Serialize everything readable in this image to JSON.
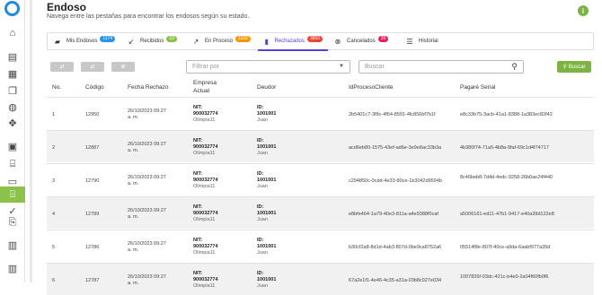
{
  "app": {
    "title": "Endoso",
    "subtitle": "Navega entre las pestañas para encontrar los endosos según su estado."
  },
  "sidebar": {
    "icons": [
      "home-icon",
      "bank-icon",
      "store-icon",
      "copy-icon",
      "globe-icon",
      "move-icon",
      "clipboard-icon",
      "institution-icon",
      "document-icon",
      "endoso-icon",
      "check-icon",
      "file-export-icon",
      "chart-icon",
      "report-icon"
    ]
  },
  "tabs": [
    {
      "label": "Mis Endosos",
      "badge": "1174",
      "color": "#2196f3",
      "icon": "folder-icon"
    },
    {
      "label": "Recibidos",
      "badge": "23",
      "color": "#8bc34a",
      "icon": "arrow-down-left-icon"
    },
    {
      "label": "En Proceso",
      "badge": "1169",
      "color": "#ff9800",
      "icon": "arrow-up-right-icon"
    },
    {
      "label": "Rechazados",
      "badge": "3850",
      "color": "#f44336",
      "icon": "file-icon"
    },
    {
      "label": "Cancelados",
      "badge": "39",
      "color": "#e91e63",
      "icon": "x-circle-icon"
    },
    {
      "label": "Historial",
      "badge": "",
      "color": "",
      "icon": "list-icon"
    }
  ],
  "toolbar": {
    "filter_placeholder": "Filtrar por",
    "search_placeholder": "Buscar",
    "search_button": "Buscar"
  },
  "table": {
    "headers": {
      "no": "No.",
      "codigo": "Código",
      "fecha": "Fecha Rechazo",
      "empresa": "Empresa Actual",
      "deudor": "Deudor",
      "proceso": "IdProcesoCliente",
      "pagare": "Pagaré Serial"
    },
    "rows": [
      {
        "no": "1",
        "codigo": "12950",
        "fecha": "26/10/2023 09:27",
        "ampm": "a. m.",
        "nit_label": "NIT:",
        "nit": "900032774",
        "empresa": "Olimpia11",
        "id_label": "ID:",
        "id": "1001001",
        "deudor": "Juan",
        "proceso": "2b5401c7-3f8c-4f64-8591-4fc856bf7b1f",
        "pagare": "e8c33b75-3acb-41a1-8388-1a383ec82f42"
      },
      {
        "no": "2",
        "codigo": "12887",
        "fecha": "26/10/2023 09:27",
        "ampm": "a. m.",
        "nit_label": "NIT:",
        "nit": "900032774",
        "empresa": "Olimpia11",
        "id_label": "ID:",
        "id": "1001001",
        "deudor": "Juan",
        "proceso": "acd6eb80-1575-43ef-ad6e-3e9e8ac33b3a",
        "pagare": "4b380f74-71a5-4b8a-9faf-69c1d4f74717"
      },
      {
        "no": "3",
        "codigo": "12790",
        "fecha": "26/10/2023 09:27",
        "ampm": "a. m.",
        "nit_label": "NIT:",
        "nit": "900032774",
        "empresa": "Olimpia11",
        "id_label": "ID:",
        "id": "1001001",
        "deudor": "Juan",
        "proceso": "c294850c-0cdd-4e33-80ce-1b3042d9594b",
        "pagare": "8c46beb8-7d4d-4edc-9258-26b0ae24f440"
      },
      {
        "no": "4",
        "codigo": "12789",
        "fecha": "26/10/2023 09:27",
        "ampm": "a. m.",
        "nit_label": "NIT:",
        "nit": "900032774",
        "empresa": "Olimpia11",
        "id_label": "ID:",
        "id": "1001001",
        "deudor": "Juan",
        "proceso": "e8bfe464-1a79-40e3-811a-a4e9388f0caf",
        "pagare": "a5006161-ed11-47b1-9417-e40a39d122e8"
      },
      {
        "no": "5",
        "codigo": "12786",
        "fecha": "26/10/2023 09:27",
        "ampm": "a. m.",
        "nit_label": "NIT:",
        "nit": "900032774",
        "empresa": "Olimpia11",
        "id_label": "ID:",
        "id": "1001001",
        "deudor": "Juan",
        "proceso": "b30cf2a8-8d1d-4ab3-807d-0be9ca8752a6",
        "pagare": "05514f8e-807f-40ce-a9da-6aabf977a35d"
      },
      {
        "no": "6",
        "codigo": "12787",
        "fecha": "26/10/2023 09:27",
        "ampm": "a. m.",
        "nit_label": "NIT:",
        "nit": "900032774",
        "empresa": "Olimpia11",
        "id_label": "ID:",
        "id": "1001001",
        "deudor": "Juan",
        "proceso": "67a2e1f1-4e46-4c35-a31a-03b8c027e034",
        "pagare": "1007826f-03dc-421c-b4e0-2a04f60fb0f6"
      }
    ]
  }
}
